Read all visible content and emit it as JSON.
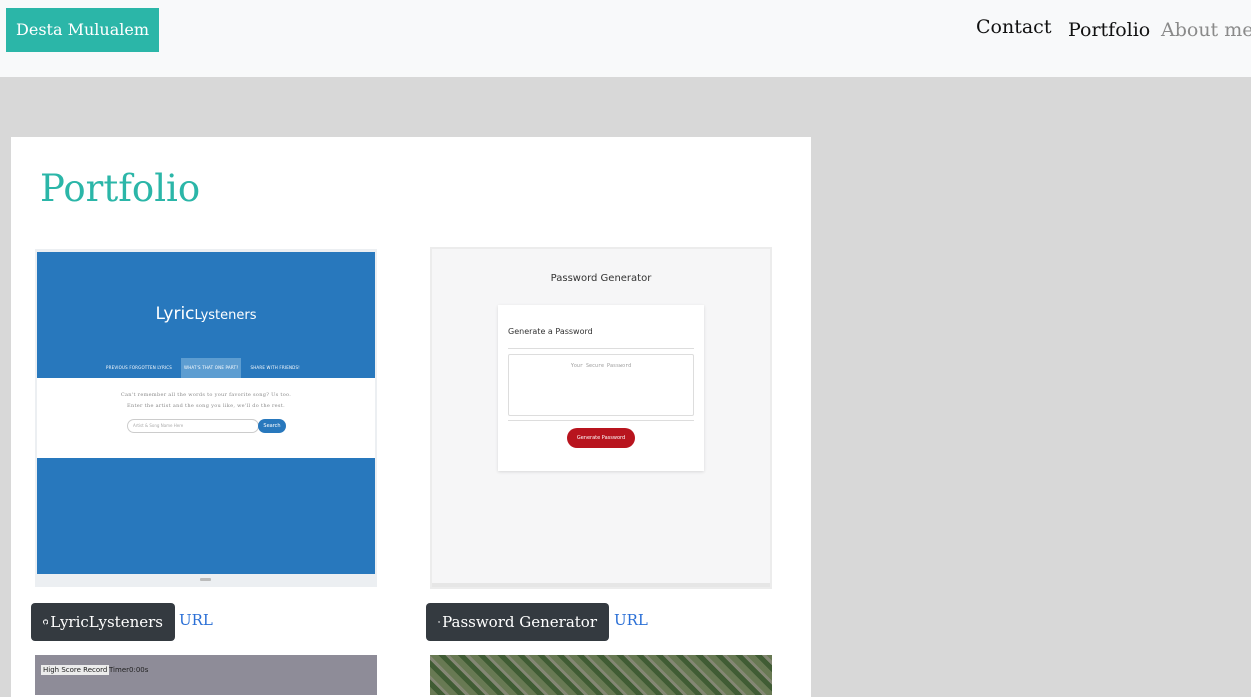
{
  "nav": {
    "brand": "Desta Mulualem",
    "links": [
      "Contact",
      "Portfolio",
      "About me"
    ]
  },
  "portfolio": {
    "title": "Portfolio",
    "projects": [
      {
        "github_label": "LyricLysteners",
        "url_label": "URL",
        "thumbnail": {
          "logo_main": "Lyric",
          "logo_sub": "Lysteners",
          "tabs": [
            "PREVIOUS FORGOTTEN LYRICS",
            "WHAT'S THAT ONE PART?",
            "SHARE WITH FRIENDS!"
          ],
          "text_line1": "Can't remember all the words to your favorite song? Us too.",
          "text_line2": "Enter the artist and the song you like, we'll do the rest.",
          "search_placeholder": "Artist & Song Name Here",
          "search_button": "Search"
        }
      },
      {
        "github_label": "Password Generator",
        "url_label": "URL",
        "thumbnail": {
          "title": "Password Generator",
          "card_title": "Generate a Password",
          "placeholder": "Your Secure Password",
          "button": "Generate Password"
        }
      },
      {
        "thumbnail": {
          "label": "High Score Record",
          "timer": "Timer0:00s"
        }
      },
      {
        "thumbnail": {}
      }
    ]
  },
  "colors": {
    "accent": "#2bb6a8",
    "navbar_bg": "#f8f9fa",
    "page_bg": "#d8d8d8",
    "button_dark": "#343a40",
    "link": "#2a6fd6"
  },
  "icons": {
    "github": "github-icon"
  }
}
